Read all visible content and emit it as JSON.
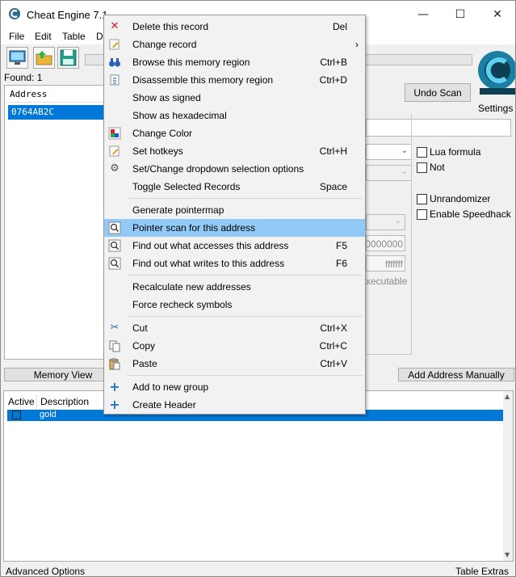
{
  "window": {
    "title": "Cheat Engine 7.1",
    "controls": {
      "minimize": "—",
      "maximize": "☐",
      "close": "✕"
    }
  },
  "menubar": [
    "File",
    "Edit",
    "Table",
    "D"
  ],
  "found_label": "Found: 1",
  "found_list": {
    "column_header": "Address",
    "rows": [
      "0764AB2C"
    ]
  },
  "buttons": {
    "undo_scan": "Undo Scan",
    "settings": "Settings",
    "memory_view": "Memory View",
    "add_address_manually": "Add Address Manually"
  },
  "checkboxes": {
    "lua_formula": "Lua formula",
    "not": "Not",
    "unrandomizer": "Unrandomizer",
    "enable_speedhack": "Enable Speedhack"
  },
  "scan_fields": {
    "start_fragment": "0000000",
    "stop_fragment": "fffffff",
    "executable_fragment": "xecutable"
  },
  "bottom_table": {
    "headers": [
      "Active",
      "Description"
    ],
    "rows": [
      {
        "description": "gold"
      }
    ]
  },
  "status_bar": {
    "advanced_options": "Advanced Options",
    "table_extras": "Table Extras"
  },
  "context_menu": {
    "items": [
      {
        "label": "Delete this record",
        "shortcut": "Del",
        "icon": "delete-x-icon"
      },
      {
        "label": "Change record",
        "shortcut": "›",
        "icon": "edit-record-icon"
      },
      {
        "label": "Browse this memory region",
        "shortcut": "Ctrl+B",
        "icon": "binoculars-icon"
      },
      {
        "label": "Disassemble this memory region",
        "shortcut": "Ctrl+D",
        "icon": "disassemble-icon"
      },
      {
        "label": "Show as signed",
        "shortcut": "",
        "icon": ""
      },
      {
        "label": "Show as hexadecimal",
        "shortcut": "",
        "icon": ""
      },
      {
        "label": "Change Color",
        "shortcut": "",
        "icon": "color-palette-icon"
      },
      {
        "label": "Set hotkeys",
        "shortcut": "Ctrl+H",
        "icon": "hotkey-icon"
      },
      {
        "label": "Set/Change dropdown selection options",
        "shortcut": "",
        "icon": "gear-icon"
      },
      {
        "label": "Toggle Selected Records",
        "shortcut": "Space",
        "icon": ""
      },
      {
        "label": "Generate pointermap",
        "shortcut": "",
        "icon": ""
      },
      {
        "label": "Pointer scan for this address",
        "shortcut": "",
        "icon": "pointer-scan-icon"
      },
      {
        "label": "Find out what accesses this address",
        "shortcut": "F5",
        "icon": "find-access-icon"
      },
      {
        "label": "Find out what writes to this address",
        "shortcut": "F6",
        "icon": "find-writes-icon"
      },
      {
        "label": "Recalculate new addresses",
        "shortcut": "",
        "icon": ""
      },
      {
        "label": "Force recheck symbols",
        "shortcut": "",
        "icon": ""
      },
      {
        "label": "Cut",
        "shortcut": "Ctrl+X",
        "icon": "scissors-icon"
      },
      {
        "label": "Copy",
        "shortcut": "Ctrl+C",
        "icon": "copy-icon"
      },
      {
        "label": "Paste",
        "shortcut": "Ctrl+V",
        "icon": "paste-icon"
      },
      {
        "label": "Add to new group",
        "shortcut": "",
        "icon": "plus-icon"
      },
      {
        "label": "Create Header",
        "shortcut": "",
        "icon": "plus-icon"
      }
    ]
  },
  "colors": {
    "selection": "#0078d7",
    "menu_highlight": "#91c9f7",
    "delete_icon": "#e81123",
    "plus_icon": "#1e78d2"
  }
}
